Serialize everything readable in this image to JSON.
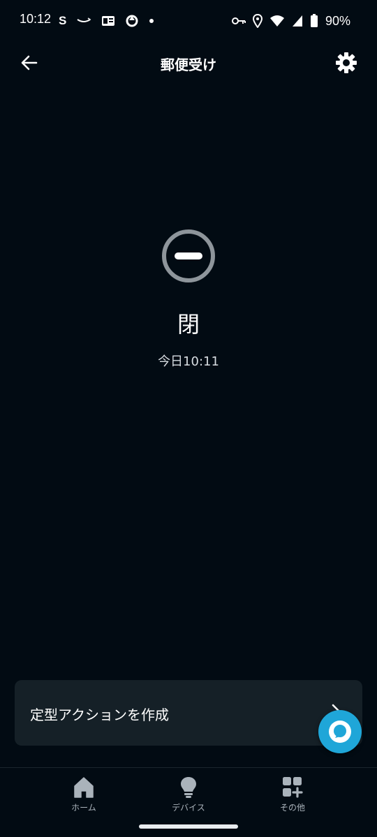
{
  "status_bar": {
    "time": "10:12",
    "left_icons": [
      "s-icon",
      "amazon-smile-icon",
      "news-icon",
      "sync-icon",
      "dot-icon"
    ],
    "right_icons": [
      "vpn-key-icon",
      "location-icon",
      "wifi-icon",
      "signal-icon",
      "battery-icon"
    ],
    "battery_percent": "90%"
  },
  "header": {
    "title": "郵便受け"
  },
  "device_state": {
    "icon": "closed-minus-icon",
    "label": "閉",
    "timestamp": "今日10:11"
  },
  "routine_card": {
    "label": "定型アクションを作成"
  },
  "alexa_button": {
    "icon": "alexa-icon"
  },
  "bottom_nav": {
    "items": [
      {
        "label": "ホーム",
        "icon": "home-icon"
      },
      {
        "label": "デバイス",
        "icon": "lightbulb-icon"
      },
      {
        "label": "その他",
        "icon": "grid-plus-icon"
      }
    ]
  },
  "colors": {
    "background": "#020b13",
    "card": "#152027",
    "alexa_accent": "#1fa6d8",
    "nav_label": "#aab3bb"
  }
}
